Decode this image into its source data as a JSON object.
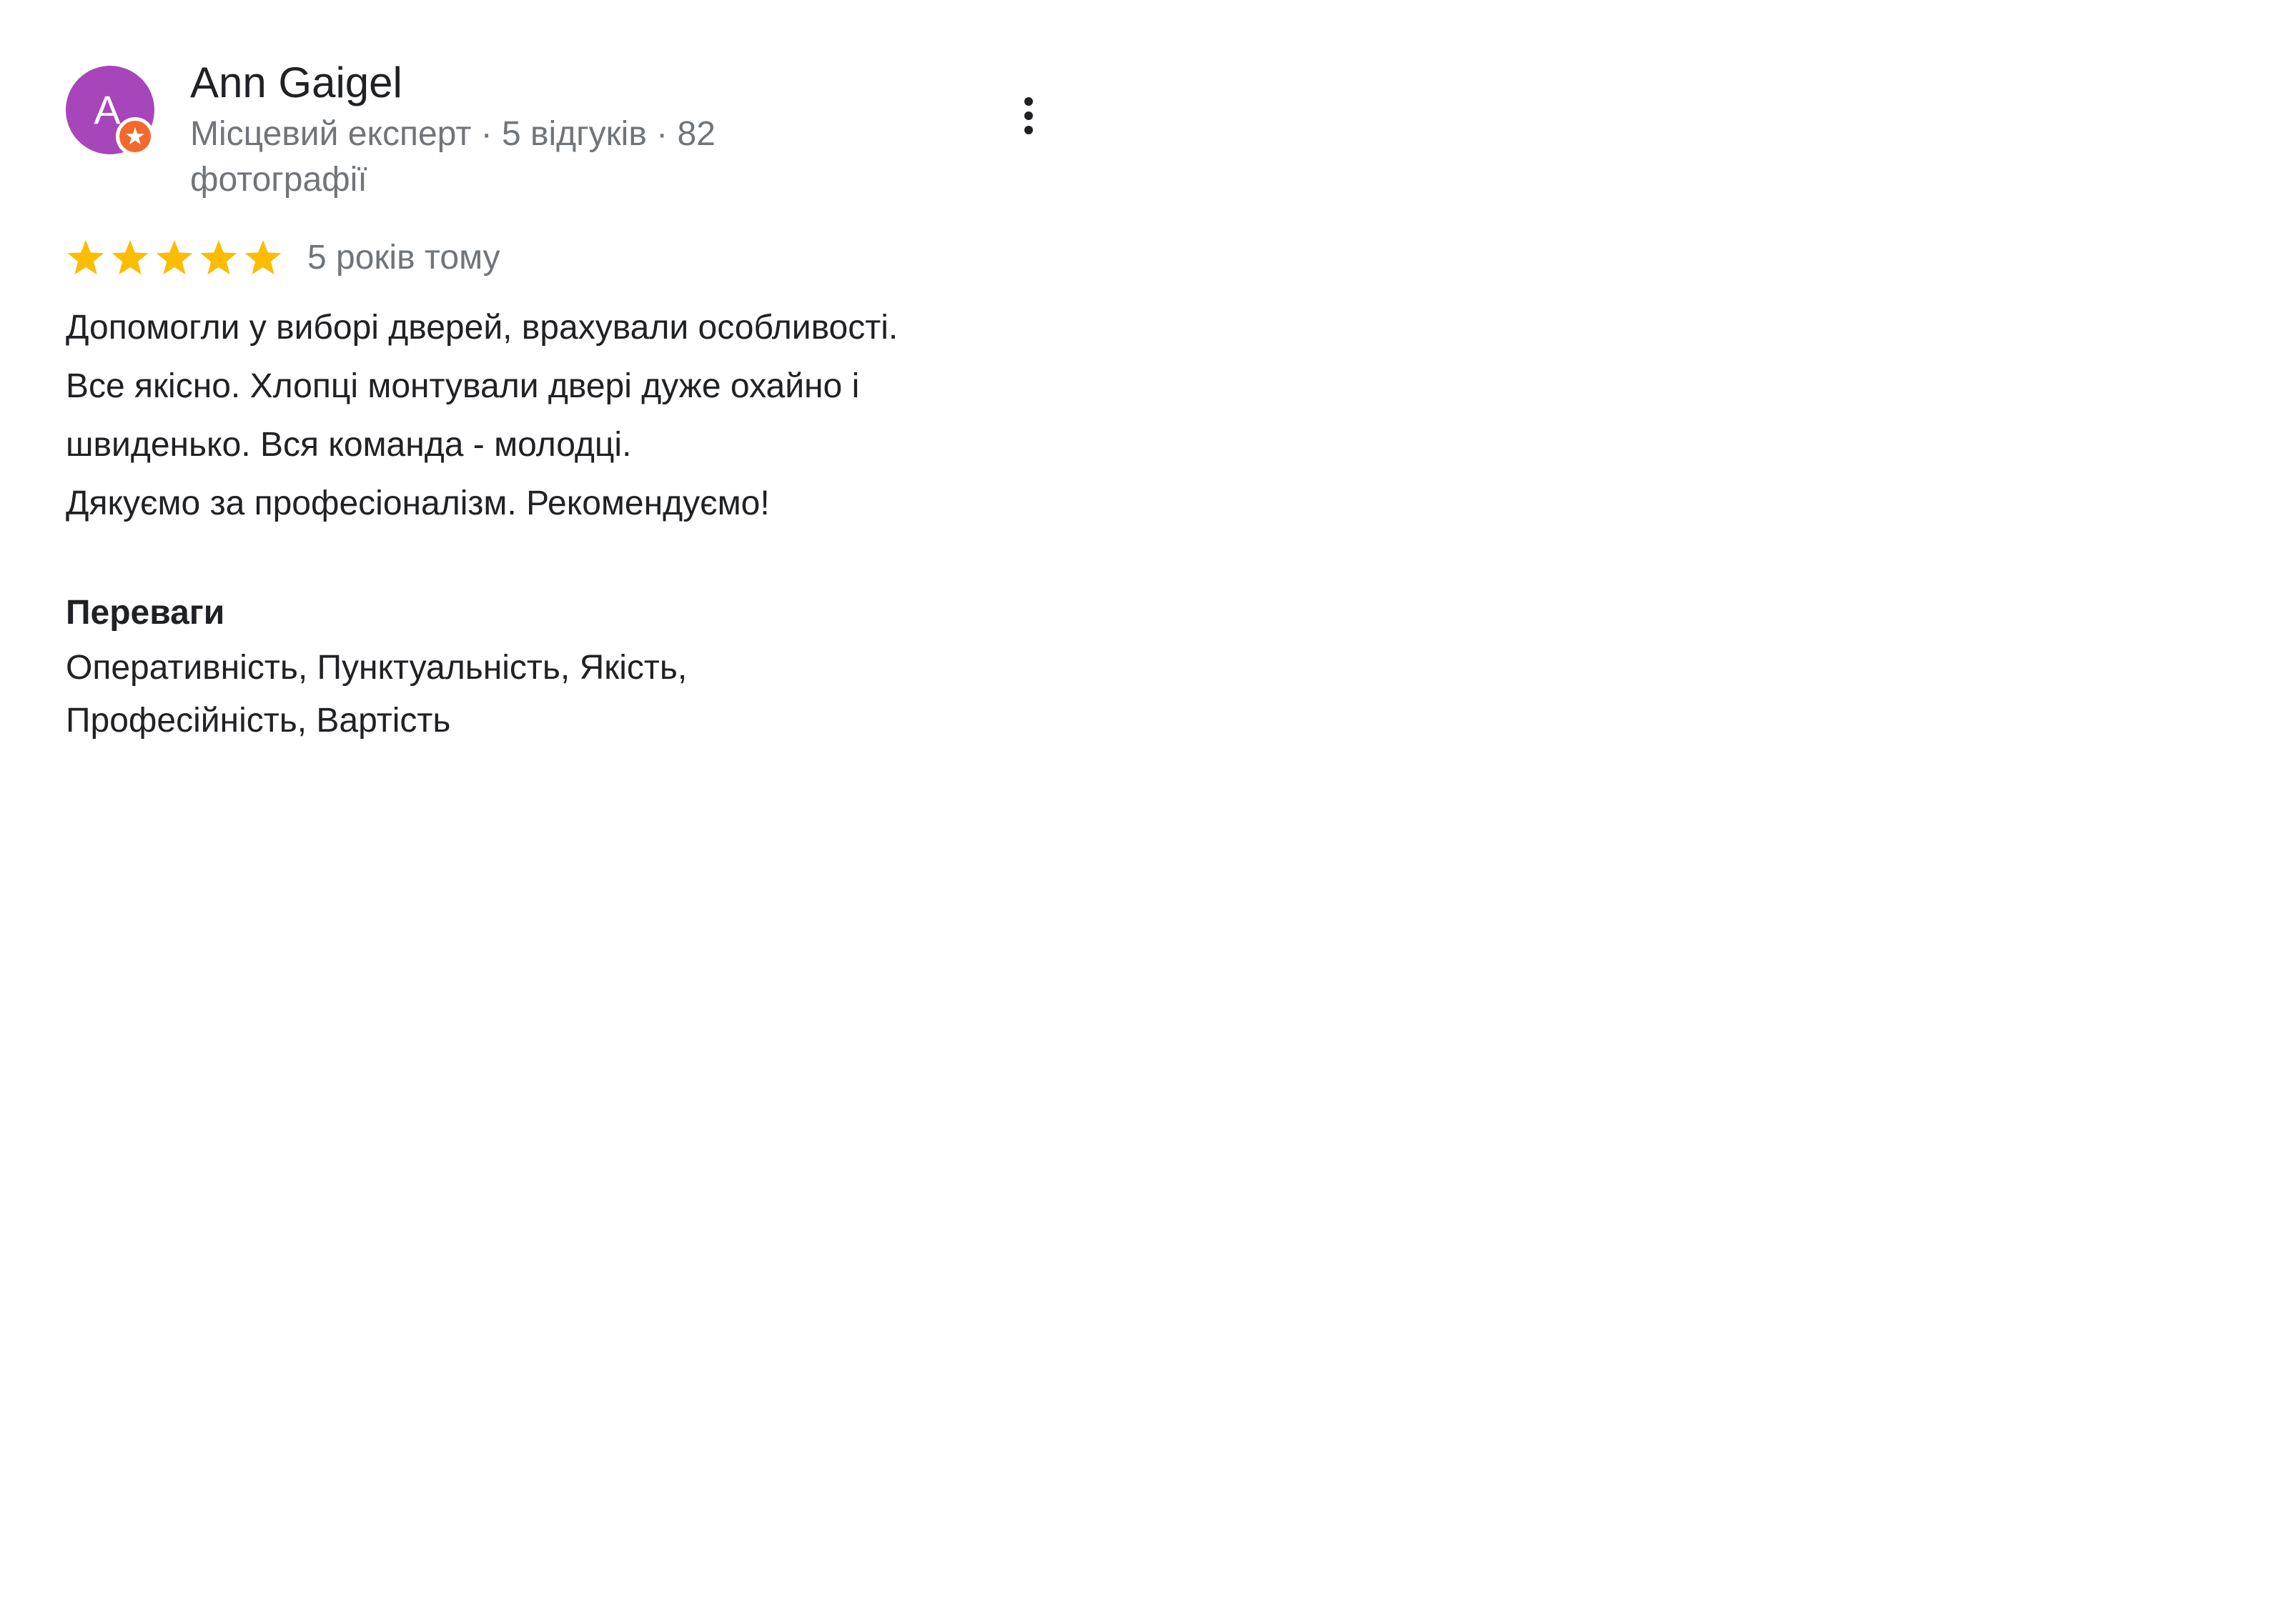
{
  "reviewer": {
    "name": "Ann Gaigel",
    "avatar_letter": "A",
    "meta": "Місцевий експерт · 5 відгуків · 82 фотографії"
  },
  "rating": {
    "stars": 5,
    "max_stars": 5,
    "date": "5 років тому"
  },
  "review": {
    "lines": [
      "Допомогли у виборі дверей, врахували особливості.",
      "Все якісно. Хлопці монтували двері дуже охайно і",
      "швиденько. Вся команда - молодці.",
      "Дякуємо за професіоналізм. Рекомендуємо!"
    ]
  },
  "pros": {
    "heading": "Переваги",
    "value": "Оперативність, Пунктуальність, Якість, Професійність, Вартість"
  },
  "icons": {
    "more": "more-vert-icon",
    "star": "star-icon",
    "badge": "local-guide-badge-icon"
  },
  "colors": {
    "avatar": "#a746bb",
    "star": "#fbbc04",
    "badge": "#f2692d",
    "text": "#202124",
    "secondary_text": "#70757a"
  }
}
